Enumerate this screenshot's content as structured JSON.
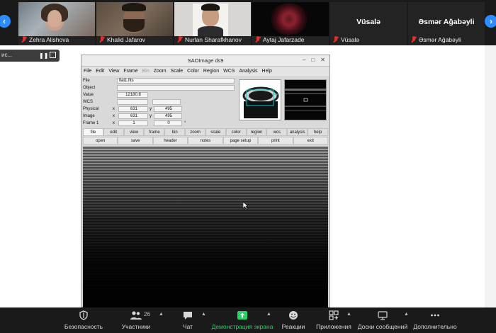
{
  "participants": [
    {
      "name": "Zehra Alishova",
      "muted": true,
      "kind": "video"
    },
    {
      "name": "Khalid Jafarov",
      "muted": true,
      "kind": "video"
    },
    {
      "name": "Nurlan Sharafkhanov",
      "muted": true,
      "kind": "video"
    },
    {
      "name": "Aytaj Jafarzade",
      "muted": true,
      "kind": "image"
    },
    {
      "name": "Vüsalə",
      "muted": true,
      "kind": "name",
      "big_name": "Vüsalə"
    },
    {
      "name": "Əsmər Ağabəyli",
      "muted": true,
      "kind": "name",
      "big_name": "Əsmər Ağabəyli"
    }
  ],
  "share_strip": {
    "text": "ис..."
  },
  "ds9": {
    "title": "SAOImage ds9",
    "menu": [
      "File",
      "Edit",
      "View",
      "Frame",
      "Bin",
      "Zoom",
      "Scale",
      "Color",
      "Region",
      "WCS",
      "Analysis",
      "Help"
    ],
    "menu_disabled": [
      "Bin"
    ],
    "info": {
      "file_label": "File",
      "file_value": "flat1.fits",
      "object_label": "Object",
      "value_label": "Value",
      "value_value": "12180.8",
      "wcs_label": "WCS",
      "physical_label": "Physical",
      "physical_x": "631",
      "physical_y": "495",
      "image_label": "Image",
      "image_x": "631",
      "image_y": "495",
      "frame_label": "Frame 1",
      "frame_x": "1",
      "frame_y": "0",
      "frame_unit": "°",
      "x_axis": "x",
      "y_axis": "y"
    },
    "buttonbar_top": [
      "file",
      "edit",
      "view",
      "frame",
      "bin",
      "zoom",
      "scale",
      "color",
      "region",
      "wcs",
      "analysis",
      "help"
    ],
    "buttonbar_active": "file",
    "buttonbar_bottom": [
      "open",
      "save",
      "header",
      "notes",
      "page setup",
      "print",
      "exit"
    ]
  },
  "toolbar": {
    "security": "Безопасность",
    "participants": "Участники",
    "participants_count": "26",
    "chat": "Чат",
    "share": "Демонстрация экрана",
    "reactions": "Реакции",
    "apps": "Приложения",
    "whiteboards": "Доски сообщений",
    "more": "Дополнительно"
  },
  "colors": {
    "zoom_blue": "#2d8cff",
    "muted_red": "#e02f2f",
    "share_green": "#25d366"
  }
}
